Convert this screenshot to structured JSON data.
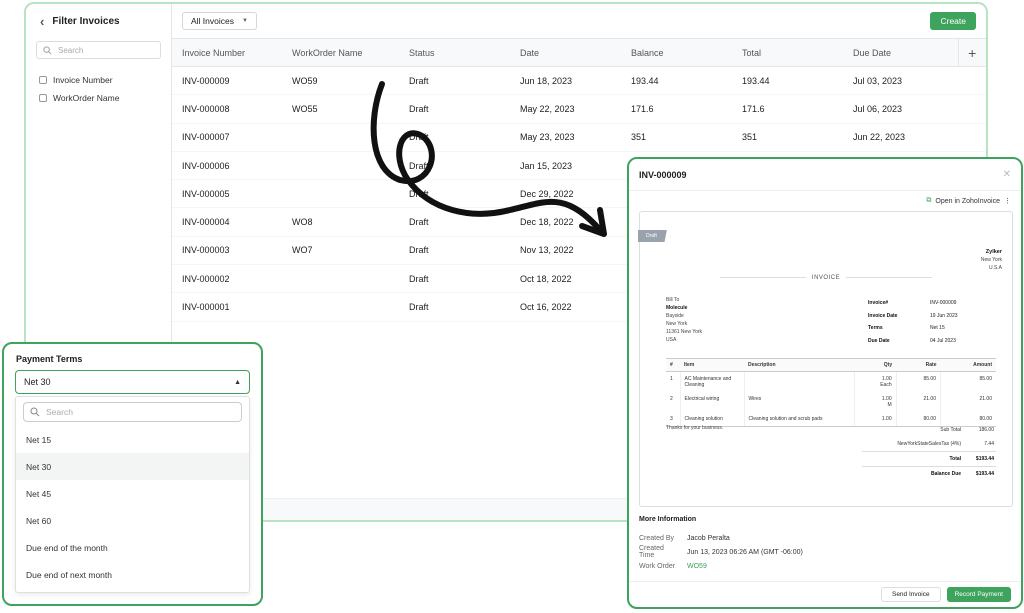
{
  "sidebar": {
    "title": "Filter Invoices",
    "search_placeholder": "Search",
    "filters": [
      "Invoice Number",
      "WorkOrder Name"
    ]
  },
  "toolbar": {
    "filter_dropdown": "All Invoices",
    "create_label": "Create"
  },
  "table": {
    "headers": [
      "Invoice Number",
      "WorkOrder Name",
      "Status",
      "Date",
      "Balance",
      "Total",
      "Due Date"
    ],
    "rows": [
      [
        "INV-000009",
        "WO59",
        "Draft",
        "Jun 18, 2023",
        "193.44",
        "193.44",
        "Jul 03, 2023"
      ],
      [
        "INV-000008",
        "WO55",
        "Draft",
        "May 22, 2023",
        "171.6",
        "171.6",
        "Jul 06, 2023"
      ],
      [
        "INV-000007",
        "",
        "Draft",
        "May 23, 2023",
        "351",
        "351",
        "Jun 22, 2023"
      ],
      [
        "INV-000006",
        "",
        "Draft",
        "Jan 15, 2023",
        "",
        "",
        ""
      ],
      [
        "INV-000005",
        "",
        "Draft",
        "Dec 29, 2022",
        "",
        "",
        ""
      ],
      [
        "INV-000004",
        "WO8",
        "Draft",
        "Dec 18, 2022",
        "",
        "",
        ""
      ],
      [
        "INV-000003",
        "WO7",
        "Draft",
        "Nov 13, 2022",
        "",
        "",
        ""
      ],
      [
        "INV-000002",
        "",
        "Draft",
        "Oct 18, 2022",
        "",
        "",
        ""
      ],
      [
        "INV-000001",
        "",
        "Draft",
        "Oct 16, 2022",
        "",
        "",
        ""
      ]
    ]
  },
  "payment_terms": {
    "title": "Payment Terms",
    "selected": "Net 30",
    "search_placeholder": "Search",
    "options": [
      "Net 15",
      "Net 30",
      "Net 45",
      "Net 60",
      "Due end of the month",
      "Due end of next month"
    ]
  },
  "detail": {
    "title": "INV-000009",
    "open_link": "Open in ZohoInvoice",
    "status_ribbon": "Draft",
    "org": {
      "name": "Zylker",
      "city": "New York",
      "country": "U.S.A"
    },
    "doc_label": "INVOICE",
    "bill_to": {
      "label": "Bill To",
      "name": "Molecule",
      "lines": [
        "Bayside",
        "New York",
        "11361 New York",
        "USA"
      ]
    },
    "meta": [
      {
        "k": "Invoice#",
        "v": "INV-000009"
      },
      {
        "k": "Invoice Date",
        "v": "19 Jun 2023"
      },
      {
        "k": "Terms",
        "v": "Net 15"
      },
      {
        "k": "Due Date",
        "v": "04 Jul 2023"
      }
    ],
    "item_headers": [
      "#",
      "Item",
      "Description",
      "Qty",
      "Rate",
      "Amount"
    ],
    "items": [
      {
        "n": "1",
        "item": "AC Maintenance and Cleaning",
        "desc": "",
        "qty": "1.00",
        "unit": "Each",
        "rate": "85.00",
        "amount": "85.00"
      },
      {
        "n": "2",
        "item": "Electrical wiring",
        "desc": "Wires",
        "qty": "1.00",
        "unit": "M",
        "rate": "21.00",
        "amount": "21.00"
      },
      {
        "n": "3",
        "item": "Cleaning solution",
        "desc": "Cleaning solution and scrub pads",
        "qty": "1.00",
        "unit": "",
        "rate": "80.00",
        "amount": "80.00"
      }
    ],
    "thanks": "Thanks for your business.",
    "totals": [
      {
        "k": "Sub Total",
        "v": "186.00"
      },
      {
        "k": "NewYorkStateSalesTax (4%)",
        "v": "7.44"
      },
      {
        "k": "Total",
        "v": "$193.44"
      },
      {
        "k": "Balance Due",
        "v": "$193.44"
      }
    ],
    "more": {
      "title": "More Information",
      "created_by_label": "Created By",
      "created_by": "Jacob Peralta",
      "created_time_label": "Created Time",
      "created_time": "Jun 13, 2023 06:26 AM (GMT -06:00)",
      "work_order_label": "Work Order",
      "work_order": "WO59"
    },
    "send_label": "Send Invoice",
    "record_label": "Record Payment"
  },
  "colors": {
    "accent": "#3da35d",
    "window_border": "#b8e3c3"
  }
}
